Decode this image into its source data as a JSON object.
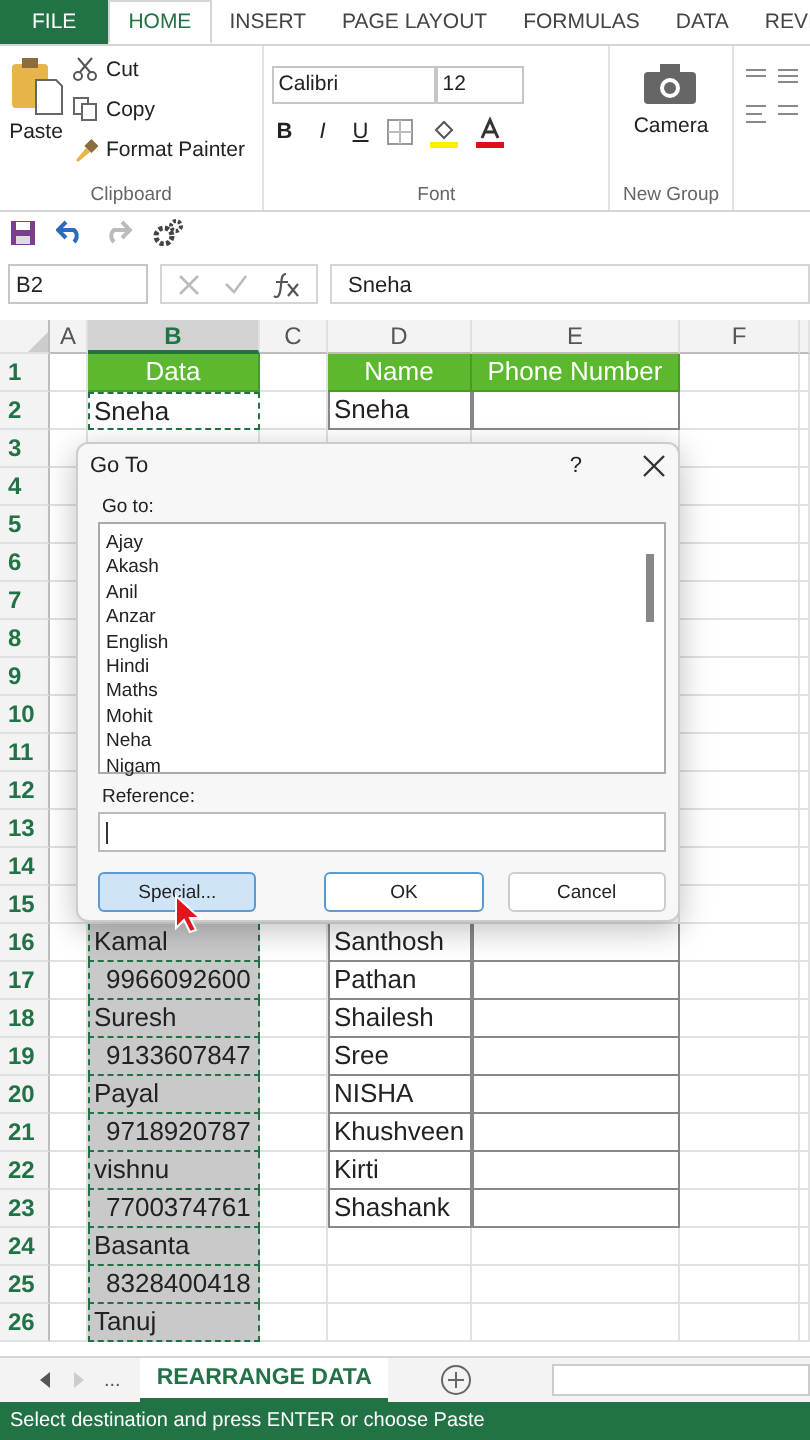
{
  "ribbon_tabs": [
    {
      "label": "FILE",
      "kind": "file",
      "selected": false
    },
    {
      "label": "HOME",
      "kind": "tab",
      "selected": true
    },
    {
      "label": "INSERT",
      "kind": "tab",
      "selected": false
    },
    {
      "label": "PAGE LAYOUT",
      "kind": "tab",
      "selected": false
    },
    {
      "label": "FORMULAS",
      "kind": "tab",
      "selected": false
    },
    {
      "label": "DATA",
      "kind": "tab",
      "selected": false
    },
    {
      "label": "REVI",
      "kind": "tab",
      "selected": false
    }
  ],
  "clipboard": {
    "paste": "Paste",
    "cut": "Cut",
    "copy": "Copy",
    "format_painter": "Format Painter",
    "label": "Clipboard"
  },
  "font": {
    "family": "Calibri",
    "size": "12",
    "label": "Font",
    "bold": "B",
    "italic": "I",
    "underline": "U"
  },
  "new_group": {
    "camera": "Camera",
    "label": "New Group"
  },
  "formula_bar": {
    "name_box": "B2",
    "value": "Sneha"
  },
  "columns": [
    {
      "label": "A",
      "selected": false
    },
    {
      "label": "B",
      "selected": true
    },
    {
      "label": "C",
      "selected": false
    },
    {
      "label": "D",
      "selected": false
    },
    {
      "label": "E",
      "selected": false
    },
    {
      "label": "F",
      "selected": false
    }
  ],
  "rows": [
    {
      "num": "1",
      "b": {
        "text": "Data",
        "kind": "header",
        "selected": false
      },
      "d": {
        "text": "Name",
        "kind": "header"
      },
      "e": {
        "text": "Phone Number",
        "kind": "header"
      }
    },
    {
      "num": "2",
      "in_table": true,
      "b": {
        "text": "Sneha",
        "kind": "text",
        "selected": true,
        "active": true
      },
      "d": {
        "text": "Sneha",
        "kind": "text"
      }
    },
    {
      "num": "3"
    },
    {
      "num": "4"
    },
    {
      "num": "5"
    },
    {
      "num": "6"
    },
    {
      "num": "7"
    },
    {
      "num": "8"
    },
    {
      "num": "9"
    },
    {
      "num": "10"
    },
    {
      "num": "11"
    },
    {
      "num": "12"
    },
    {
      "num": "13"
    },
    {
      "num": "14"
    },
    {
      "num": "15"
    },
    {
      "num": "16",
      "in_table": true,
      "b": {
        "text": "Kamal",
        "kind": "text",
        "selected": true
      },
      "d": {
        "text": "Santhosh",
        "kind": "text"
      }
    },
    {
      "num": "17",
      "in_table": true,
      "b": {
        "text": "9966092600",
        "kind": "number",
        "selected": true
      },
      "d": {
        "text": "Pathan",
        "kind": "text"
      }
    },
    {
      "num": "18",
      "in_table": true,
      "b": {
        "text": "Suresh",
        "kind": "text",
        "selected": true
      },
      "d": {
        "text": "Shailesh",
        "kind": "text"
      }
    },
    {
      "num": "19",
      "in_table": true,
      "b": {
        "text": "9133607847",
        "kind": "number",
        "selected": true
      },
      "d": {
        "text": "Sree",
        "kind": "text"
      }
    },
    {
      "num": "20",
      "in_table": true,
      "b": {
        "text": "Payal",
        "kind": "text",
        "selected": true
      },
      "d": {
        "text": "NISHA",
        "kind": "text"
      }
    },
    {
      "num": "21",
      "in_table": true,
      "b": {
        "text": "9718920787",
        "kind": "number",
        "selected": true
      },
      "d": {
        "text": "Khushveen",
        "kind": "text"
      }
    },
    {
      "num": "22",
      "in_table": true,
      "b": {
        "text": "vishnu",
        "kind": "text",
        "selected": true
      },
      "d": {
        "text": "Kirti",
        "kind": "text"
      }
    },
    {
      "num": "23",
      "in_table": true,
      "b": {
        "text": "7700374761",
        "kind": "number",
        "selected": true
      },
      "d": {
        "text": "Shashank",
        "kind": "text"
      }
    },
    {
      "num": "24",
      "in_table": false,
      "b": {
        "text": "Basanta",
        "kind": "text",
        "selected": true
      }
    },
    {
      "num": "25",
      "in_table": false,
      "b": {
        "text": "8328400418",
        "kind": "number",
        "selected": true
      }
    },
    {
      "num": "26",
      "in_table": false,
      "b": {
        "text": "Tanuj",
        "kind": "text",
        "selected": true
      }
    }
  ],
  "dialog": {
    "title": "Go To",
    "help": "?",
    "goto_label": "Go to:",
    "items": [
      "Ajay",
      "Akash",
      "Anil",
      "Anzar",
      "English",
      "Hindi",
      "Maths",
      "Mohit",
      "Neha",
      "Nigam"
    ],
    "reference_label": "Reference:",
    "buttons": [
      {
        "label": "Special...",
        "kind": "focused"
      },
      {
        "label": "OK",
        "kind": "default"
      },
      {
        "label": "Cancel",
        "kind": "plain"
      }
    ]
  },
  "sheet_tabs": {
    "more": "...",
    "tabs": [
      {
        "label": "REARRANGE DATA",
        "selected": true
      }
    ]
  },
  "status_bar": "Select destination and press ENTER or choose Paste"
}
